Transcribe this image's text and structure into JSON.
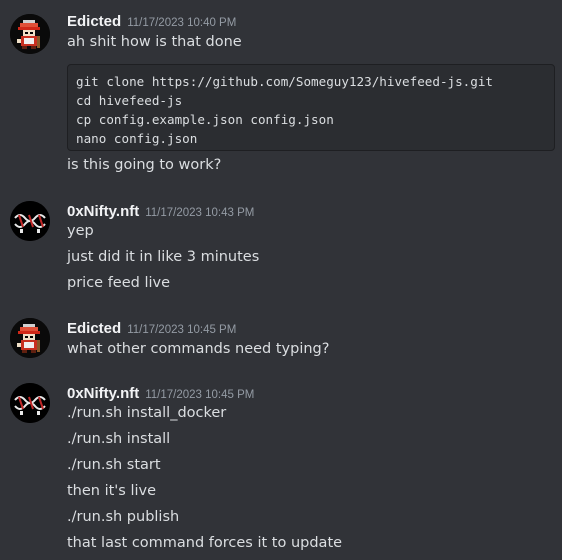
{
  "messages": [
    {
      "author": "Edicted",
      "timestamp": "11/17/2023 10:40 PM",
      "lines_before": [
        "ah shit how is that done"
      ],
      "code": [
        "git clone https://github.com/Someguy123/hivefeed-js.git",
        "cd hivefeed-js",
        "cp config.example.json config.json",
        "nano config.json"
      ],
      "lines_after": [
        "is this going to work?"
      ]
    },
    {
      "author": "0xNifty.nft",
      "timestamp": "11/17/2023 10:43 PM",
      "lines": [
        "yep",
        "just did it in like 3 minutes",
        "price feed live"
      ]
    },
    {
      "author": "Edicted",
      "timestamp": "11/17/2023 10:45 PM",
      "lines": [
        "what other commands need typing?"
      ]
    },
    {
      "author": "0xNifty.nft",
      "timestamp": "11/17/2023 10:45 PM",
      "lines": [
        "./run.sh install_docker",
        "./run.sh install",
        "./run.sh start",
        "then it's live",
        "./run.sh publish",
        "that last command forces it to update"
      ]
    }
  ],
  "colors": {
    "background": "#313338",
    "code_background": "#2b2d31",
    "username": "#f2f3f5",
    "timestamp": "#949ba4",
    "text": "#dbdee1"
  }
}
